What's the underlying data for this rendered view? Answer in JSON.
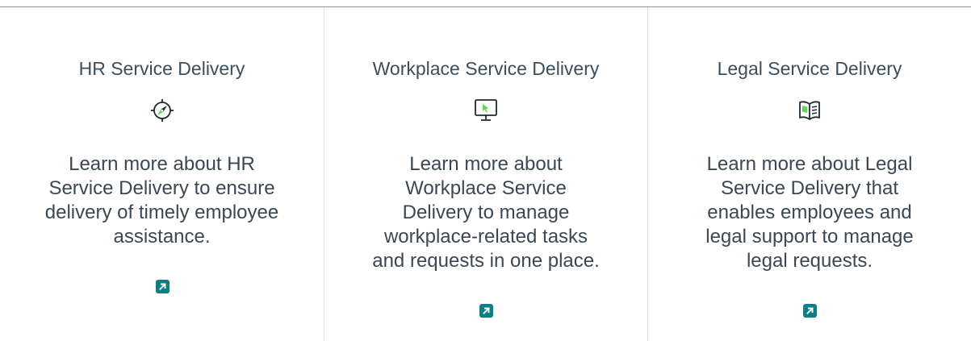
{
  "cards": [
    {
      "title": "HR Service Delivery",
      "icon": "compass-icon",
      "description": "Learn more about HR Service Delivery to ensure delivery of timely employee assistance.",
      "link_icon": "arrow-up-right-icon"
    },
    {
      "title": "Workplace Service Delivery",
      "icon": "monitor-cursor-icon",
      "description": "Learn more about Workplace Service Delivery to manage workplace-related tasks and requests in one place.",
      "link_icon": "arrow-up-right-icon"
    },
    {
      "title": "Legal Service Delivery",
      "icon": "open-book-icon",
      "description": "Learn more about Legal Service Delivery that enables employees and legal support to manage legal requests.",
      "link_icon": "arrow-up-right-icon"
    }
  ],
  "colors": {
    "accent": "#0b7f86",
    "icon_green": "#62d84e",
    "text": "#3a4856",
    "divider": "#e2e5e8"
  }
}
